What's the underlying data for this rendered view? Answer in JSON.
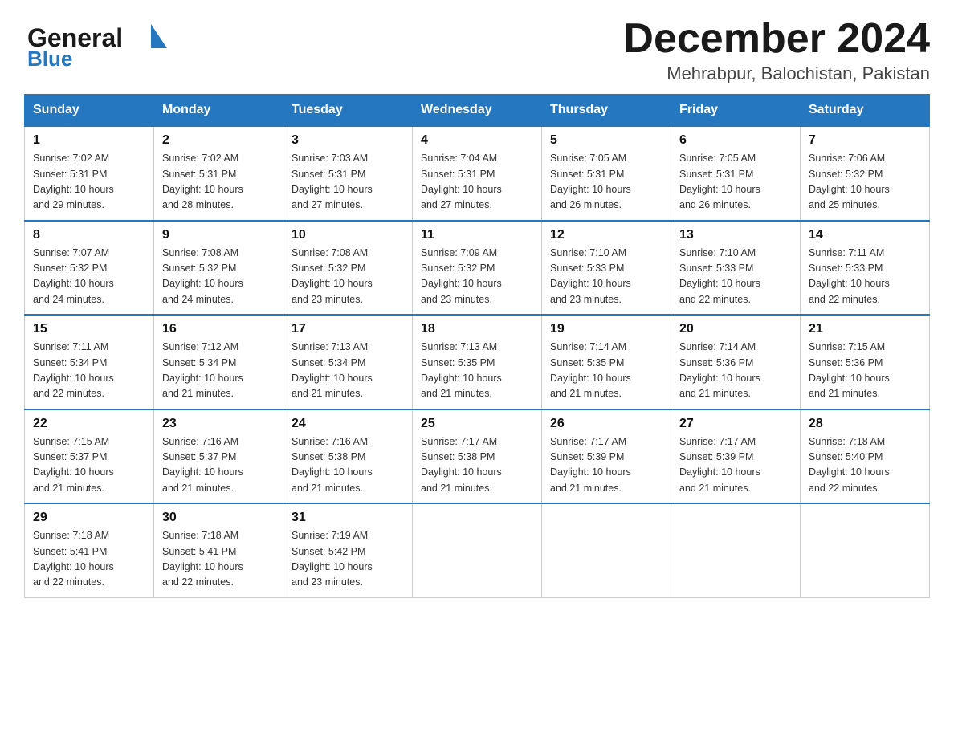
{
  "logo": {
    "general": "General",
    "blue": "Blue",
    "triangle_char": "▶"
  },
  "header": {
    "month_year": "December 2024",
    "location": "Mehrabpur, Balochistan, Pakistan"
  },
  "weekdays": [
    "Sunday",
    "Monday",
    "Tuesday",
    "Wednesday",
    "Thursday",
    "Friday",
    "Saturday"
  ],
  "weeks": [
    [
      {
        "day": "1",
        "sunrise": "7:02 AM",
        "sunset": "5:31 PM",
        "daylight": "10 hours and 29 minutes."
      },
      {
        "day": "2",
        "sunrise": "7:02 AM",
        "sunset": "5:31 PM",
        "daylight": "10 hours and 28 minutes."
      },
      {
        "day": "3",
        "sunrise": "7:03 AM",
        "sunset": "5:31 PM",
        "daylight": "10 hours and 27 minutes."
      },
      {
        "day": "4",
        "sunrise": "7:04 AM",
        "sunset": "5:31 PM",
        "daylight": "10 hours and 27 minutes."
      },
      {
        "day": "5",
        "sunrise": "7:05 AM",
        "sunset": "5:31 PM",
        "daylight": "10 hours and 26 minutes."
      },
      {
        "day": "6",
        "sunrise": "7:05 AM",
        "sunset": "5:31 PM",
        "daylight": "10 hours and 26 minutes."
      },
      {
        "day": "7",
        "sunrise": "7:06 AM",
        "sunset": "5:32 PM",
        "daylight": "10 hours and 25 minutes."
      }
    ],
    [
      {
        "day": "8",
        "sunrise": "7:07 AM",
        "sunset": "5:32 PM",
        "daylight": "10 hours and 24 minutes."
      },
      {
        "day": "9",
        "sunrise": "7:08 AM",
        "sunset": "5:32 PM",
        "daylight": "10 hours and 24 minutes."
      },
      {
        "day": "10",
        "sunrise": "7:08 AM",
        "sunset": "5:32 PM",
        "daylight": "10 hours and 23 minutes."
      },
      {
        "day": "11",
        "sunrise": "7:09 AM",
        "sunset": "5:32 PM",
        "daylight": "10 hours and 23 minutes."
      },
      {
        "day": "12",
        "sunrise": "7:10 AM",
        "sunset": "5:33 PM",
        "daylight": "10 hours and 23 minutes."
      },
      {
        "day": "13",
        "sunrise": "7:10 AM",
        "sunset": "5:33 PM",
        "daylight": "10 hours and 22 minutes."
      },
      {
        "day": "14",
        "sunrise": "7:11 AM",
        "sunset": "5:33 PM",
        "daylight": "10 hours and 22 minutes."
      }
    ],
    [
      {
        "day": "15",
        "sunrise": "7:11 AM",
        "sunset": "5:34 PM",
        "daylight": "10 hours and 22 minutes."
      },
      {
        "day": "16",
        "sunrise": "7:12 AM",
        "sunset": "5:34 PM",
        "daylight": "10 hours and 21 minutes."
      },
      {
        "day": "17",
        "sunrise": "7:13 AM",
        "sunset": "5:34 PM",
        "daylight": "10 hours and 21 minutes."
      },
      {
        "day": "18",
        "sunrise": "7:13 AM",
        "sunset": "5:35 PM",
        "daylight": "10 hours and 21 minutes."
      },
      {
        "day": "19",
        "sunrise": "7:14 AM",
        "sunset": "5:35 PM",
        "daylight": "10 hours and 21 minutes."
      },
      {
        "day": "20",
        "sunrise": "7:14 AM",
        "sunset": "5:36 PM",
        "daylight": "10 hours and 21 minutes."
      },
      {
        "day": "21",
        "sunrise": "7:15 AM",
        "sunset": "5:36 PM",
        "daylight": "10 hours and 21 minutes."
      }
    ],
    [
      {
        "day": "22",
        "sunrise": "7:15 AM",
        "sunset": "5:37 PM",
        "daylight": "10 hours and 21 minutes."
      },
      {
        "day": "23",
        "sunrise": "7:16 AM",
        "sunset": "5:37 PM",
        "daylight": "10 hours and 21 minutes."
      },
      {
        "day": "24",
        "sunrise": "7:16 AM",
        "sunset": "5:38 PM",
        "daylight": "10 hours and 21 minutes."
      },
      {
        "day": "25",
        "sunrise": "7:17 AM",
        "sunset": "5:38 PM",
        "daylight": "10 hours and 21 minutes."
      },
      {
        "day": "26",
        "sunrise": "7:17 AM",
        "sunset": "5:39 PM",
        "daylight": "10 hours and 21 minutes."
      },
      {
        "day": "27",
        "sunrise": "7:17 AM",
        "sunset": "5:39 PM",
        "daylight": "10 hours and 21 minutes."
      },
      {
        "day": "28",
        "sunrise": "7:18 AM",
        "sunset": "5:40 PM",
        "daylight": "10 hours and 22 minutes."
      }
    ],
    [
      {
        "day": "29",
        "sunrise": "7:18 AM",
        "sunset": "5:41 PM",
        "daylight": "10 hours and 22 minutes."
      },
      {
        "day": "30",
        "sunrise": "7:18 AM",
        "sunset": "5:41 PM",
        "daylight": "10 hours and 22 minutes."
      },
      {
        "day": "31",
        "sunrise": "7:19 AM",
        "sunset": "5:42 PM",
        "daylight": "10 hours and 23 minutes."
      },
      null,
      null,
      null,
      null
    ]
  ],
  "labels": {
    "sunrise": "Sunrise:",
    "sunset": "Sunset:",
    "daylight": "Daylight:"
  }
}
